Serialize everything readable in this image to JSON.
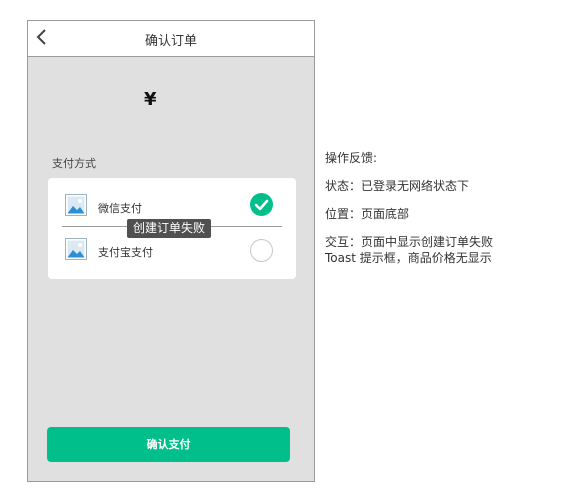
{
  "header": {
    "title": "确认订单",
    "back_icon": "chevron-left-icon"
  },
  "order": {
    "currency_symbol": "¥"
  },
  "payment": {
    "section_label": "支付方式",
    "methods": [
      {
        "label": "微信支付",
        "icon": "image-placeholder-icon",
        "selected": true
      },
      {
        "label": "支付宝支付",
        "icon": "image-placeholder-icon",
        "selected": false
      }
    ]
  },
  "toast": {
    "message": "创建订单失败"
  },
  "footer": {
    "confirm_label": "确认支付"
  },
  "annotation": {
    "title": "操作反馈:",
    "state": "状态：已登录无网络状态下",
    "position": "位置：页面底部",
    "interaction_line1": "交互：页面中显示创建订单失败",
    "interaction_line2": "Toast 提示框，商品价格无显示"
  },
  "colors": {
    "accent": "#00bf8a",
    "background": "#e0e0e0",
    "toast_bg": "#505050"
  }
}
